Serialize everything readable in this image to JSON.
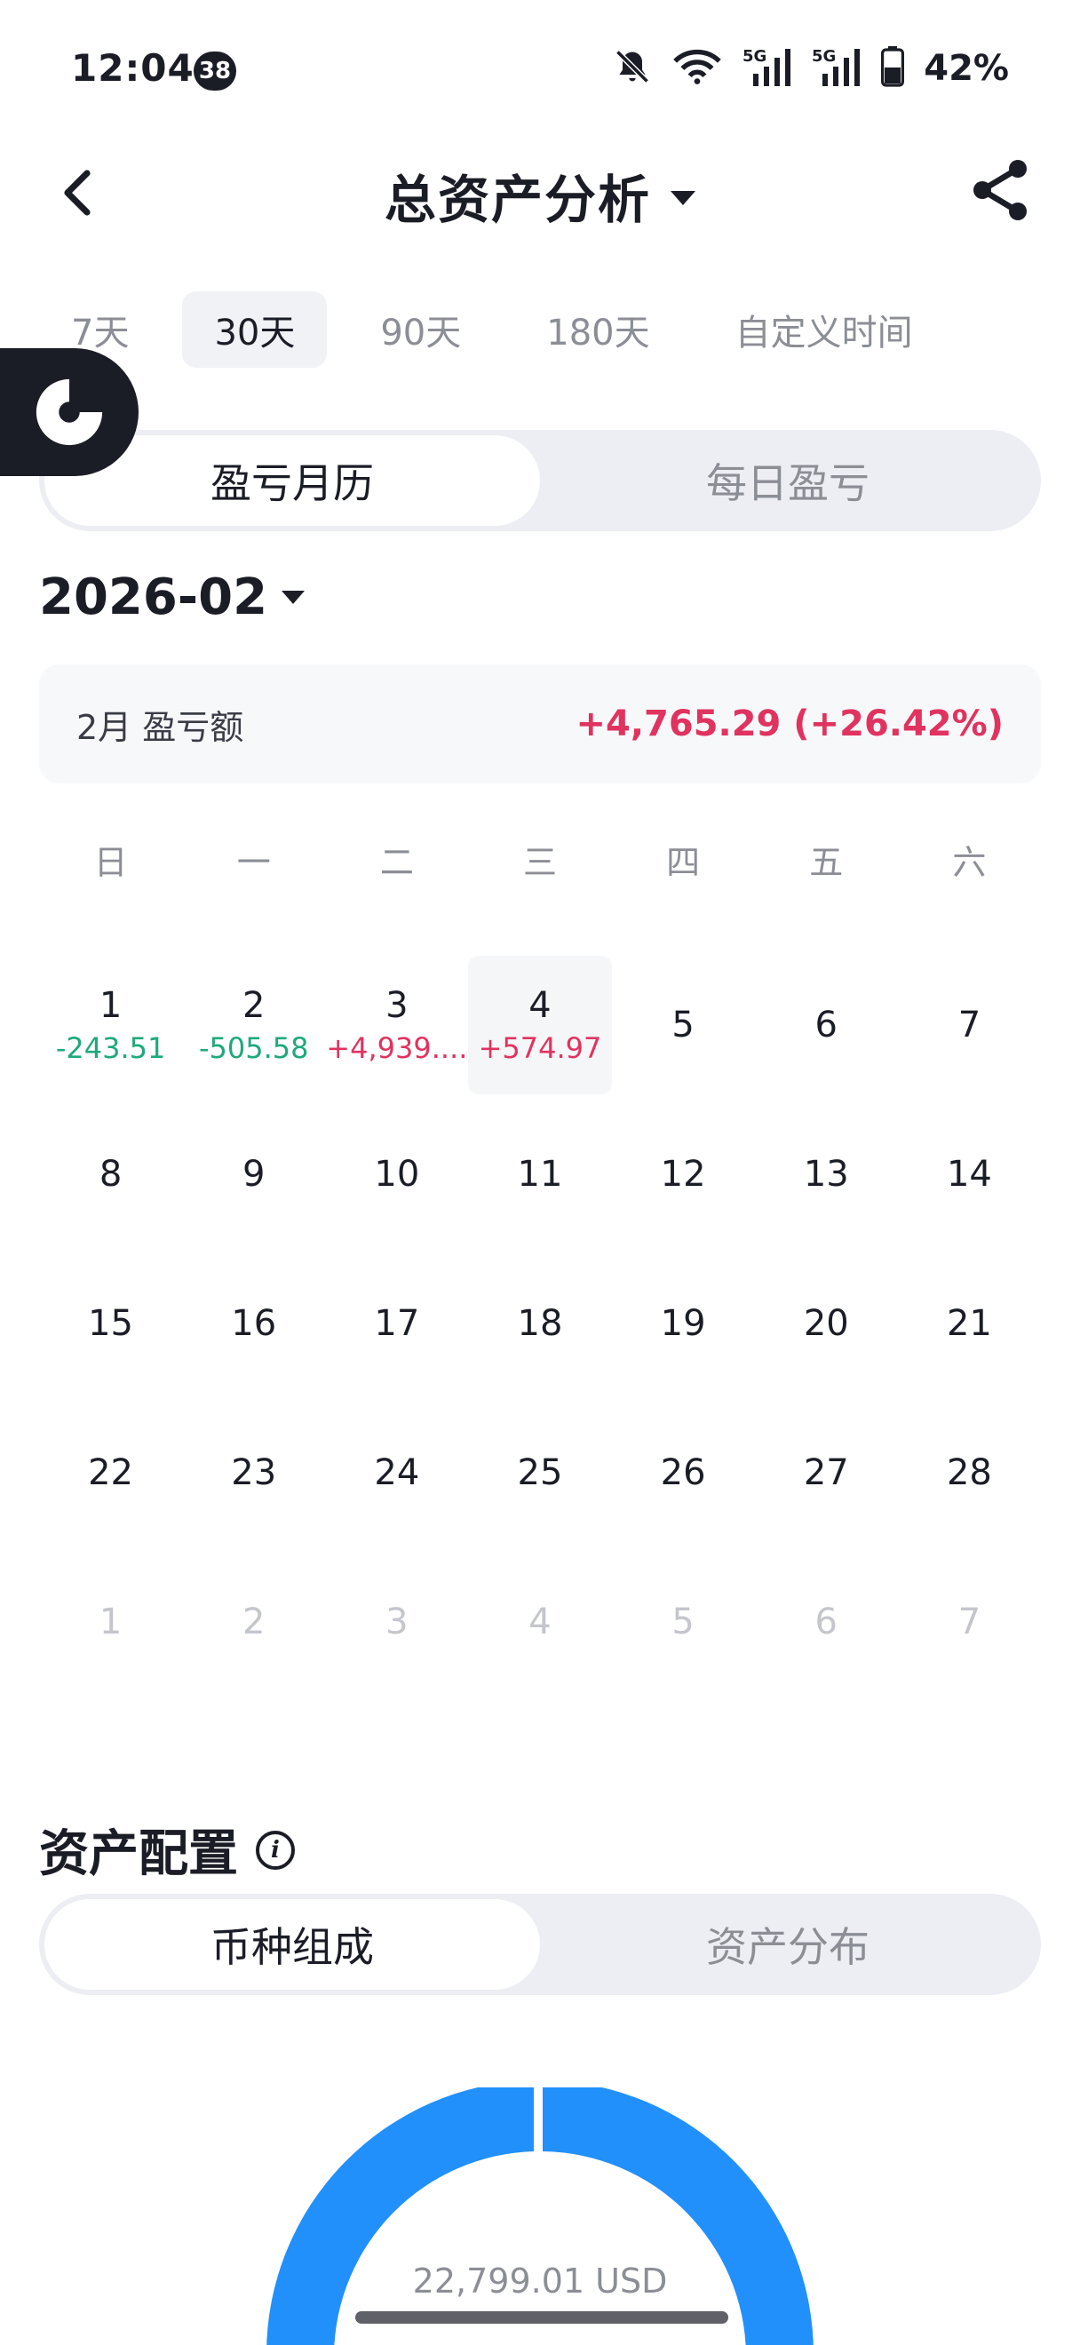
{
  "status_bar": {
    "time": "12:04",
    "notification_count": "38",
    "battery": "42%"
  },
  "header": {
    "title": "总资产分析"
  },
  "range_tabs": [
    {
      "label": "7天",
      "active": false
    },
    {
      "label": "30天",
      "active": true
    },
    {
      "label": "90天",
      "active": false
    },
    {
      "label": "180天",
      "active": false
    },
    {
      "label": "自定义时间",
      "active": false
    }
  ],
  "view_toggle": {
    "calendar": "盈亏月历",
    "daily": "每日盈亏",
    "active": "calendar"
  },
  "month_picker": {
    "value": "2026-02"
  },
  "summary": {
    "label": "2月 盈亏额",
    "value": "+4,765.29 (+26.42%)"
  },
  "weekdays": [
    "日",
    "一",
    "二",
    "三",
    "四",
    "五",
    "六"
  ],
  "calendar": [
    {
      "day": "1",
      "pnl": "-243.51",
      "sign": "neg"
    },
    {
      "day": "2",
      "pnl": "-505.58",
      "sign": "neg"
    },
    {
      "day": "3",
      "pnl": "+4,939....",
      "sign": "pos"
    },
    {
      "day": "4",
      "pnl": "+574.97",
      "sign": "pos",
      "today": true
    },
    {
      "day": "5"
    },
    {
      "day": "6"
    },
    {
      "day": "7"
    },
    {
      "day": "8"
    },
    {
      "day": "9"
    },
    {
      "day": "10"
    },
    {
      "day": "11"
    },
    {
      "day": "12"
    },
    {
      "day": "13"
    },
    {
      "day": "14"
    },
    {
      "day": "15"
    },
    {
      "day": "16"
    },
    {
      "day": "17"
    },
    {
      "day": "18"
    },
    {
      "day": "19"
    },
    {
      "day": "20"
    },
    {
      "day": "21"
    },
    {
      "day": "22"
    },
    {
      "day": "23"
    },
    {
      "day": "24"
    },
    {
      "day": "25"
    },
    {
      "day": "26"
    },
    {
      "day": "27"
    },
    {
      "day": "28"
    },
    {
      "day": "1",
      "muted": true
    },
    {
      "day": "2",
      "muted": true
    },
    {
      "day": "3",
      "muted": true
    },
    {
      "day": "4",
      "muted": true
    },
    {
      "day": "5",
      "muted": true
    },
    {
      "day": "6",
      "muted": true
    },
    {
      "day": "7",
      "muted": true
    }
  ],
  "allocation": {
    "title": "资产配置",
    "tabs": {
      "currency": "币种组成",
      "distribution": "资产分布",
      "active": "currency"
    },
    "total": "22,799.01 USD",
    "gauge_color": "#2190fa"
  }
}
